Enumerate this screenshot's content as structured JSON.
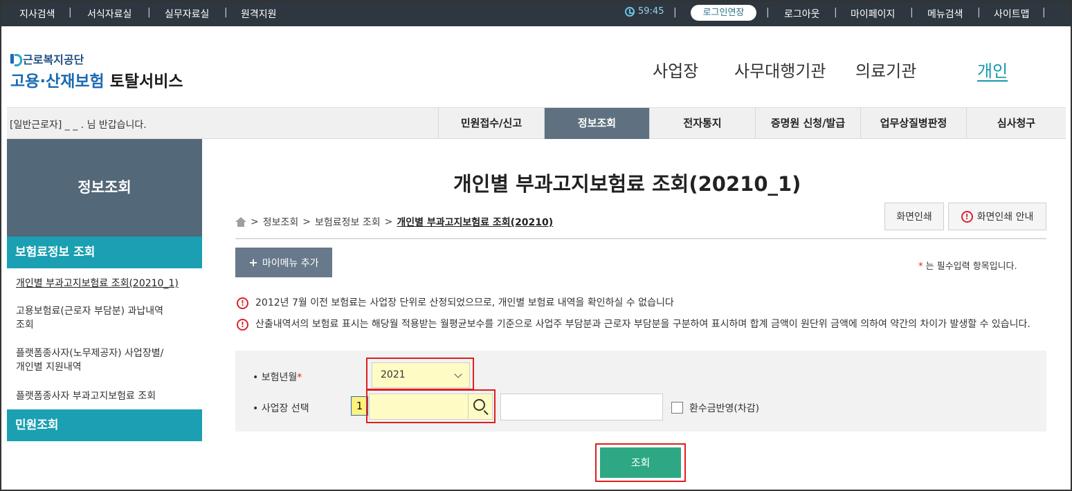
{
  "topbar": {
    "links_left": [
      "지사검색",
      "서식자료실",
      "실무자료실",
      "원격지원"
    ],
    "timer": "59:45",
    "extend_login": "로그인연장",
    "links_right": [
      "로그아웃",
      "마이페이지",
      "메뉴검색",
      "사이트맵"
    ],
    "separator": "|"
  },
  "header": {
    "org_name": "근로복지공단",
    "service_blue": "고용·산재보험",
    "service_black": "토탈서비스",
    "gnb": [
      "사업장",
      "사무대행기관",
      "의료기관",
      "개인"
    ]
  },
  "subnav": {
    "welcome": "[일반근로자] _ _ . 님 반갑습니다.",
    "tabs": [
      "민원접수/신고",
      "정보조회",
      "전자통지",
      "증명원 신청/발급",
      "업무상질병판정",
      "심사청구"
    ]
  },
  "sidebar": {
    "title": "정보조회",
    "group1": "보험료정보 조회",
    "items": [
      "개인별 부과고지보험료 조회(20210_1)",
      "고용보험료(근로자 부담분) 과납내역",
      "조회",
      "플랫폼종사자(노무제공자) 사업장별/",
      "개인별 지원내역",
      "플랫폼종사자 부과고지보험료 조회"
    ],
    "group2": "민원조회"
  },
  "main": {
    "title": "개인별 부과고지보험료 조회(20210_1)",
    "breadcrumb": [
      "정보조회",
      "보험료정보 조회",
      "개인별 부과고지보험료 조회(20210)"
    ],
    "breadcrumb_sep": ">",
    "print_label": "화면인쇄",
    "print_guide_label": "화면인쇄 안내",
    "mymenu_label": "마이메뉴 추가",
    "mymenu_plus": "+",
    "required_star": "*",
    "required_note": "는 필수입력 항목입니다.",
    "notice1": "2012년 7월 이전 보험료는 사업장 단위로 산정되었으므로, 개인별 보험료 내역을 확인하실 수 없습니다",
    "notice2": "산출내역서의 보험료 표시는 해당월 적용받는 월평균보수를 기준으로 사업주 부담분과 근로자 부담분을 구분하여 표시하며 합계 금액이 원단위 금액에 의하여 약간의 차이가 발생할 수 있습니다.",
    "alert_glyph": "!"
  },
  "form": {
    "year_label": "보험년월",
    "year_value": "2021",
    "biz_label": "사업장 선택",
    "bullet": "•",
    "badge": "1",
    "refund_label": "환수금반영(차감)",
    "submit": "조회"
  },
  "colors": {
    "topbar": "#2e3740",
    "accent": "#1aa0b2",
    "tab_active": "#5f7180",
    "highlight_box": "#e01e1e",
    "submit": "#2ea884",
    "field_highlight": "#fffbc4"
  }
}
